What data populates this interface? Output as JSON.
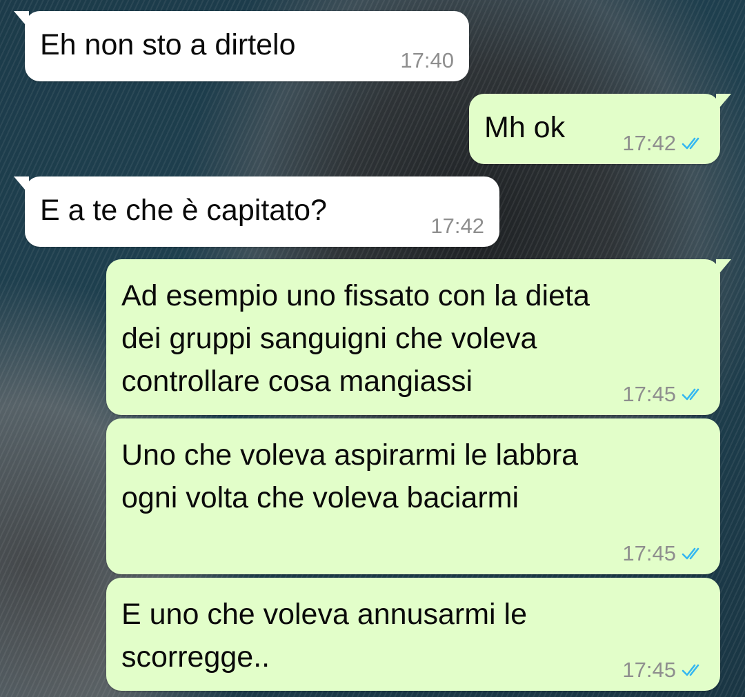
{
  "chat": {
    "messages": [
      {
        "direction": "incoming",
        "text": "Eh non sto a dirtelo",
        "time": "17:40"
      },
      {
        "direction": "outgoing",
        "text": "Mh ok",
        "time": "17:42",
        "status_icon": "double-check-read-icon"
      },
      {
        "direction": "incoming",
        "text": "E a te che è capitato?",
        "time": "17:42"
      },
      {
        "direction": "outgoing",
        "text": "Ad esempio uno fissato con la dieta\ndei gruppi sanguigni che voleva\ncontrollare cosa mangiassi",
        "time": "17:45",
        "status_icon": "double-check-read-icon"
      },
      {
        "direction": "outgoing",
        "text": "Uno che voleva aspirarmi le labbra\nogni volta che voleva baciarmi",
        "time": "17:45",
        "status_icon": "double-check-read-icon"
      },
      {
        "direction": "outgoing",
        "text": "E uno che voleva annusarmi le\nscorregge..",
        "time": "17:45",
        "status_icon": "double-check-read-icon"
      }
    ]
  },
  "colors": {
    "incoming_bubble": "#ffffff",
    "outgoing_bubble": "#e2fec9",
    "timestamp": "#8e8e8e",
    "read_ticks": "#34b7f1",
    "wallpaper_base": "#1d3a48"
  }
}
